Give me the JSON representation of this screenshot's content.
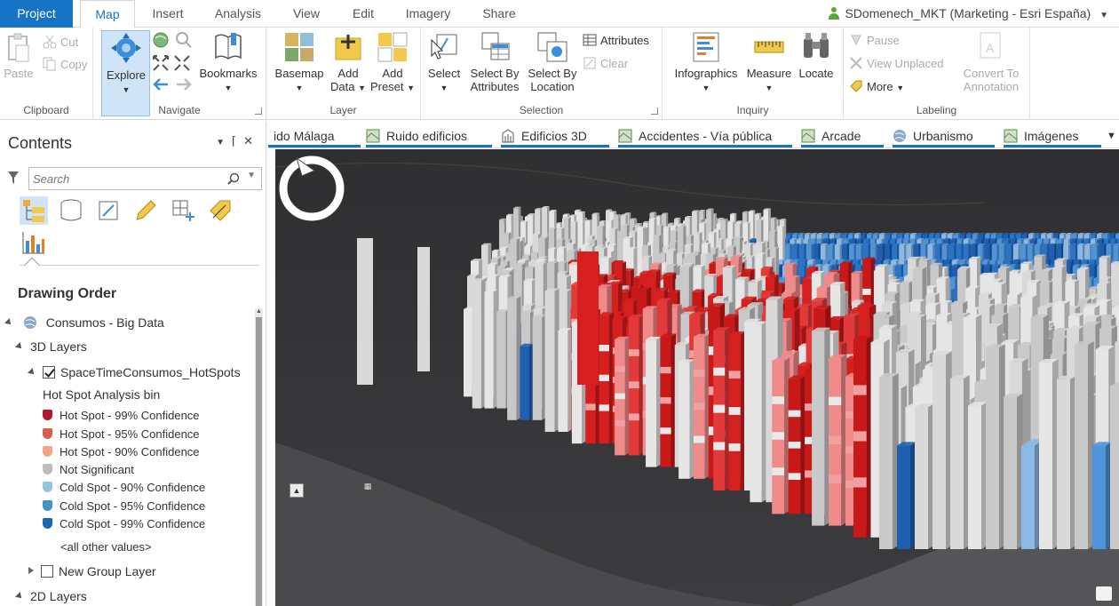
{
  "tabs": [
    "Project",
    "Map",
    "Insert",
    "Analysis",
    "View",
    "Edit",
    "Imagery",
    "Share"
  ],
  "active_tab": "Map",
  "user": "SDomenech_MKT (Marketing - Esri España)",
  "ribbon": {
    "clipboard": {
      "label": "Clipboard",
      "paste": "Paste",
      "cut": "Cut",
      "copy": "Copy"
    },
    "navigate": {
      "label": "Navigate",
      "explore": "Explore",
      "bookmarks": "Bookmarks"
    },
    "layer": {
      "label": "Layer",
      "basemap": "Basemap",
      "add_data": "Add",
      "add_data2": "Data",
      "add_preset": "Add",
      "add_preset2": "Preset"
    },
    "selection": {
      "label": "Selection",
      "select": "Select",
      "select_by_attr": "Select By",
      "select_by_attr2": "Attributes",
      "select_by_loc": "Select By",
      "select_by_loc2": "Location",
      "attributes": "Attributes",
      "clear": "Clear"
    },
    "inquiry": {
      "label": "Inquiry",
      "infographics": "Infographics",
      "measure": "Measure",
      "locate": "Locate"
    },
    "labeling": {
      "label": "Labeling",
      "pause": "Pause",
      "view_unplaced": "View Unplaced",
      "more": "More",
      "convert": "Convert To",
      "convert2": "Annotation"
    }
  },
  "contents": {
    "title": "Contents",
    "search_placeholder": "Search",
    "drawing_order": "Drawing Order",
    "map_name": "Consumos - Big Data",
    "group_3d": "3D Layers",
    "layer_name": "SpaceTimeConsumos_HotSpots",
    "legend_title": "Hot Spot Analysis bin",
    "legend": [
      {
        "label": "Hot Spot - 99% Confidence",
        "color": "#b2182b"
      },
      {
        "label": "Hot Spot - 95% Confidence",
        "color": "#d6604d"
      },
      {
        "label": "Hot Spot - 90% Confidence",
        "color": "#f4a582"
      },
      {
        "label": "Not Significant",
        "color": "#bdbdbd"
      },
      {
        "label": "Cold Spot - 90% Confidence",
        "color": "#92c5de"
      },
      {
        "label": "Cold Spot - 95% Confidence",
        "color": "#4393c3"
      },
      {
        "label": "Cold Spot - 99% Confidence",
        "color": "#2166ac"
      }
    ],
    "other_values": "<all other values>",
    "new_group": "New Group Layer",
    "group_2d": "2D Layers"
  },
  "map_tabs": [
    "ido Málaga",
    "Ruido edificios",
    "Edificios 3D",
    "Accidentes - Vía pública",
    "Arcade",
    "Urbanismo",
    "Imágenes"
  ],
  "colors": {
    "accent": "#1673c6",
    "map_bg": "#3b3b3d",
    "hot": "#d7191c",
    "cold": "#1f5fb0",
    "neutral": "#d9d9d9"
  }
}
